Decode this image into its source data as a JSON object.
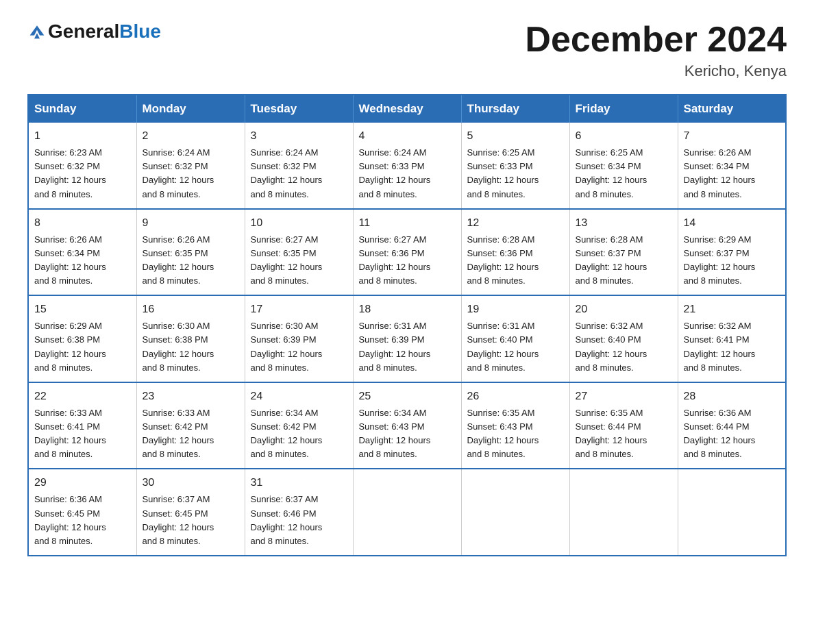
{
  "logo": {
    "general": "General",
    "blue": "Blue"
  },
  "title": {
    "month": "December 2024",
    "location": "Kericho, Kenya"
  },
  "days_of_week": [
    "Sunday",
    "Monday",
    "Tuesday",
    "Wednesday",
    "Thursday",
    "Friday",
    "Saturday"
  ],
  "weeks": [
    [
      {
        "day": "1",
        "sunrise": "6:23 AM",
        "sunset": "6:32 PM",
        "daylight": "12 hours and 8 minutes."
      },
      {
        "day": "2",
        "sunrise": "6:24 AM",
        "sunset": "6:32 PM",
        "daylight": "12 hours and 8 minutes."
      },
      {
        "day": "3",
        "sunrise": "6:24 AM",
        "sunset": "6:32 PM",
        "daylight": "12 hours and 8 minutes."
      },
      {
        "day": "4",
        "sunrise": "6:24 AM",
        "sunset": "6:33 PM",
        "daylight": "12 hours and 8 minutes."
      },
      {
        "day": "5",
        "sunrise": "6:25 AM",
        "sunset": "6:33 PM",
        "daylight": "12 hours and 8 minutes."
      },
      {
        "day": "6",
        "sunrise": "6:25 AM",
        "sunset": "6:34 PM",
        "daylight": "12 hours and 8 minutes."
      },
      {
        "day": "7",
        "sunrise": "6:26 AM",
        "sunset": "6:34 PM",
        "daylight": "12 hours and 8 minutes."
      }
    ],
    [
      {
        "day": "8",
        "sunrise": "6:26 AM",
        "sunset": "6:34 PM",
        "daylight": "12 hours and 8 minutes."
      },
      {
        "day": "9",
        "sunrise": "6:26 AM",
        "sunset": "6:35 PM",
        "daylight": "12 hours and 8 minutes."
      },
      {
        "day": "10",
        "sunrise": "6:27 AM",
        "sunset": "6:35 PM",
        "daylight": "12 hours and 8 minutes."
      },
      {
        "day": "11",
        "sunrise": "6:27 AM",
        "sunset": "6:36 PM",
        "daylight": "12 hours and 8 minutes."
      },
      {
        "day": "12",
        "sunrise": "6:28 AM",
        "sunset": "6:36 PM",
        "daylight": "12 hours and 8 minutes."
      },
      {
        "day": "13",
        "sunrise": "6:28 AM",
        "sunset": "6:37 PM",
        "daylight": "12 hours and 8 minutes."
      },
      {
        "day": "14",
        "sunrise": "6:29 AM",
        "sunset": "6:37 PM",
        "daylight": "12 hours and 8 minutes."
      }
    ],
    [
      {
        "day": "15",
        "sunrise": "6:29 AM",
        "sunset": "6:38 PM",
        "daylight": "12 hours and 8 minutes."
      },
      {
        "day": "16",
        "sunrise": "6:30 AM",
        "sunset": "6:38 PM",
        "daylight": "12 hours and 8 minutes."
      },
      {
        "day": "17",
        "sunrise": "6:30 AM",
        "sunset": "6:39 PM",
        "daylight": "12 hours and 8 minutes."
      },
      {
        "day": "18",
        "sunrise": "6:31 AM",
        "sunset": "6:39 PM",
        "daylight": "12 hours and 8 minutes."
      },
      {
        "day": "19",
        "sunrise": "6:31 AM",
        "sunset": "6:40 PM",
        "daylight": "12 hours and 8 minutes."
      },
      {
        "day": "20",
        "sunrise": "6:32 AM",
        "sunset": "6:40 PM",
        "daylight": "12 hours and 8 minutes."
      },
      {
        "day": "21",
        "sunrise": "6:32 AM",
        "sunset": "6:41 PM",
        "daylight": "12 hours and 8 minutes."
      }
    ],
    [
      {
        "day": "22",
        "sunrise": "6:33 AM",
        "sunset": "6:41 PM",
        "daylight": "12 hours and 8 minutes."
      },
      {
        "day": "23",
        "sunrise": "6:33 AM",
        "sunset": "6:42 PM",
        "daylight": "12 hours and 8 minutes."
      },
      {
        "day": "24",
        "sunrise": "6:34 AM",
        "sunset": "6:42 PM",
        "daylight": "12 hours and 8 minutes."
      },
      {
        "day": "25",
        "sunrise": "6:34 AM",
        "sunset": "6:43 PM",
        "daylight": "12 hours and 8 minutes."
      },
      {
        "day": "26",
        "sunrise": "6:35 AM",
        "sunset": "6:43 PM",
        "daylight": "12 hours and 8 minutes."
      },
      {
        "day": "27",
        "sunrise": "6:35 AM",
        "sunset": "6:44 PM",
        "daylight": "12 hours and 8 minutes."
      },
      {
        "day": "28",
        "sunrise": "6:36 AM",
        "sunset": "6:44 PM",
        "daylight": "12 hours and 8 minutes."
      }
    ],
    [
      {
        "day": "29",
        "sunrise": "6:36 AM",
        "sunset": "6:45 PM",
        "daylight": "12 hours and 8 minutes."
      },
      {
        "day": "30",
        "sunrise": "6:37 AM",
        "sunset": "6:45 PM",
        "daylight": "12 hours and 8 minutes."
      },
      {
        "day": "31",
        "sunrise": "6:37 AM",
        "sunset": "6:46 PM",
        "daylight": "12 hours and 8 minutes."
      },
      null,
      null,
      null,
      null
    ]
  ],
  "labels": {
    "sunrise": "Sunrise:",
    "sunset": "Sunset:",
    "daylight": "Daylight:"
  }
}
